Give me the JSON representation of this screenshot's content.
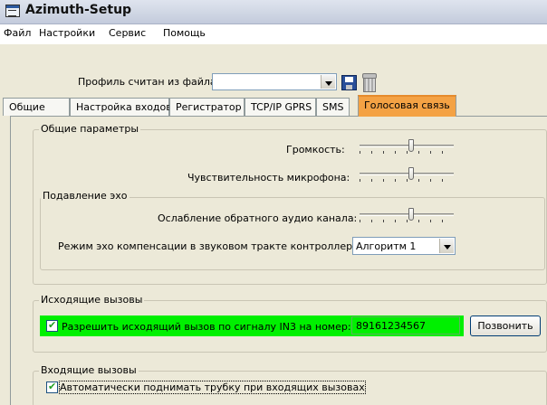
{
  "window": {
    "title": "Azimuth-Setup"
  },
  "menu": [
    "Файл",
    "Настройки",
    "Сервис",
    "Помощь"
  ],
  "profile": {
    "label": "Профиль считан из файла",
    "value": ""
  },
  "tabs": [
    "Общие",
    "Настройка входов",
    "Регистратор",
    "TCP/IP GPRS",
    "SMS",
    "Голосовая связь"
  ],
  "active_tab": "Голосовая связь",
  "general": {
    "title": "Общие параметры",
    "volume_label": "Громкость:",
    "volume_level": 0.55,
    "mic_label": "Чувствительность микрофона:",
    "mic_level": 0.55
  },
  "echo": {
    "title": "Подавление эхо",
    "attenuation_label": "Ослабление обратного аудио канала:",
    "attenuation_level": 0.55,
    "mode_label": "Режим эхо компенсации в звуковом тракте контроллера:",
    "mode_value": "Алгоритм 1"
  },
  "outgoing": {
    "title": "Исходящие вызовы",
    "checkbox_label": "Разрешить исходящий вызов по сигналу IN3 на номер:",
    "checked": true,
    "number": "89161234567",
    "call_button": "Позвонить",
    "highlight_color": "#00f000"
  },
  "incoming": {
    "title": "Входящие вызовы",
    "checkbox_label": "Автоматически поднимать трубку при входящих вызовах",
    "checked": true
  }
}
